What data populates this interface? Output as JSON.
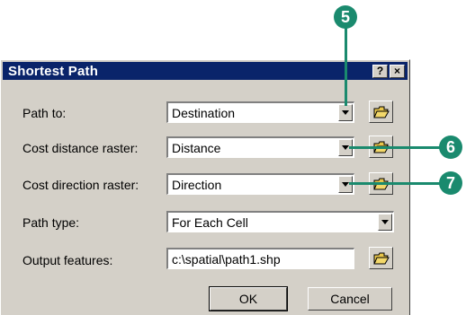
{
  "dialog": {
    "title": "Shortest Path",
    "help_button": "?",
    "close_button": "×"
  },
  "fields": [
    {
      "label": "Path to:",
      "value": "Destination",
      "type": "dropdown"
    },
    {
      "label": "Cost distance raster:",
      "value": "Distance",
      "type": "dropdown"
    },
    {
      "label": "Cost direction raster:",
      "value": "Direction",
      "type": "dropdown"
    },
    {
      "label": "Path type:",
      "value": "For Each Cell",
      "type": "dropdown"
    },
    {
      "label": "Output features:",
      "value": "c:\\spatial\\path1.shp",
      "type": "text"
    }
  ],
  "buttons": {
    "ok": "OK",
    "cancel": "Cancel"
  },
  "callouts": {
    "c5": "5",
    "c6": "6",
    "c7": "7"
  },
  "colors": {
    "title_bar": "#0a246a",
    "dialog_bg": "#d4d0c8",
    "callout": "#1a8a6e"
  }
}
